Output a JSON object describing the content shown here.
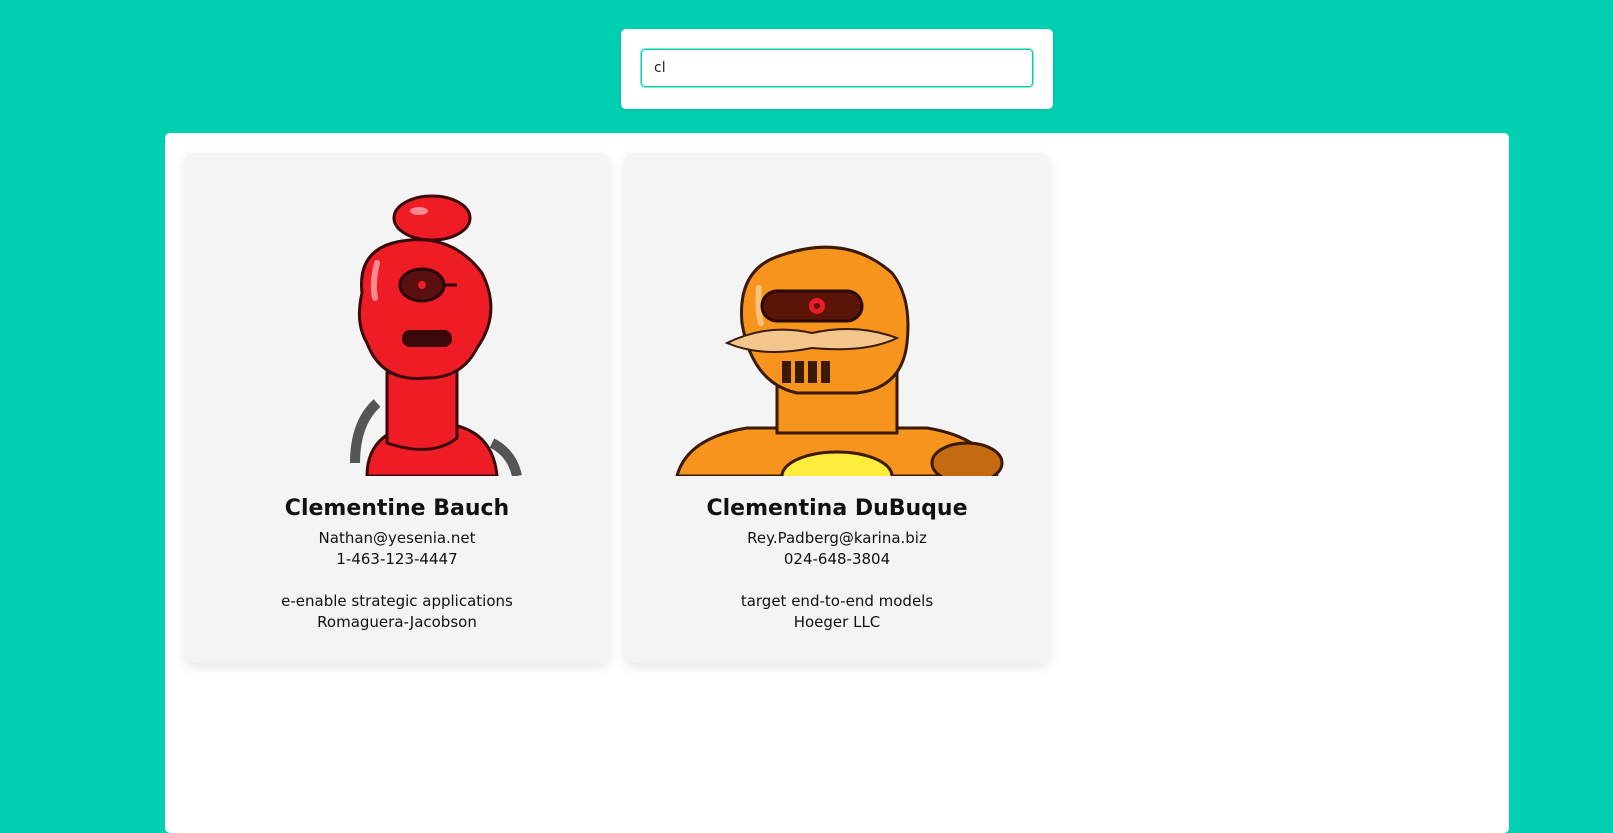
{
  "search": {
    "value": "cl",
    "placeholder": ""
  },
  "robots": [
    {
      "name": "Clementine Bauch",
      "email": "Nathan@yesenia.net",
      "phone": "1-463-123-4447",
      "catch_phrase": "e-enable strategic applications",
      "company": "Romaguera-Jacobson",
      "color": "#ee1c24"
    },
    {
      "name": "Clementina DuBuque",
      "email": "Rey.Padberg@karina.biz",
      "phone": "024-648-3804",
      "catch_phrase": "target end-to-end models",
      "company": "Hoeger LLC",
      "color": "#f7941d"
    }
  ],
  "colors": {
    "background": "#00cfb1",
    "card": "#f4f4f4"
  }
}
